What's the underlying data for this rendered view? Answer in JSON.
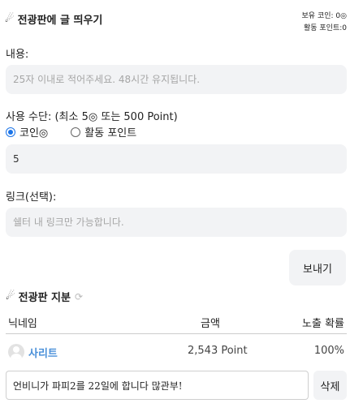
{
  "header": {
    "title_icon": "rocket-icon",
    "title": "전광판에 글 띄우기",
    "coin_balance": "보유 코인: 0◎",
    "point_balance": "활동 포인트:0"
  },
  "form": {
    "content_label": "내용:",
    "content_placeholder": "25자 이내로 적어주세요. 48시간 유지됩니다.",
    "method_label": "사용 수단: (최소 5◎ 또는 500 Point)",
    "options": [
      "코인◎",
      "활동 포인트"
    ],
    "selected_option": "코인◎",
    "amount_value": "5",
    "link_label": "링크(선택):",
    "link_placeholder": "쉘터 내 링크만 가능합니다.",
    "send_label": "보내기"
  },
  "share": {
    "title": "전광판 지분",
    "refresh_icon": "refresh-icon",
    "columns": [
      "닉네임",
      "금액",
      "노출 확률"
    ],
    "rows": [
      {
        "nickname": "사리트",
        "amount": "2,543 Point",
        "rate": "100%"
      }
    ],
    "message": "언비니가 파피2를 22일에 합니다 많관부!",
    "delete_label": "삭제"
  }
}
